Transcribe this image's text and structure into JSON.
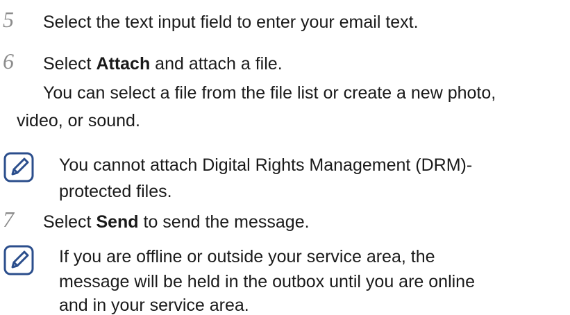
{
  "steps": [
    {
      "number": "5",
      "text": "Select the text input field to enter your email text."
    },
    {
      "number": "6",
      "pre": "Select ",
      "bold": "Attach",
      "post": " and attach a file.",
      "sub": [
        "You can select a file from the file list or create a new photo,",
        "video, or sound."
      ]
    },
    {
      "number": "7",
      "pre": "Select ",
      "bold": "Send",
      "post": " to send the message."
    }
  ],
  "notes": [
    {
      "icon": "note-pencil-icon",
      "lines": [
        "You cannot attach Digital Rights Management (DRM)-",
        "protected files."
      ]
    },
    {
      "icon": "note-pencil-icon",
      "lines": [
        "If you are offline or outside your service area, the",
        "message will be held in the outbox until you are online",
        "and in your service area."
      ]
    }
  ],
  "colors": {
    "step_number": "#8c8c8c",
    "icon_stroke": "#2b4e8c",
    "text": "#1a1a1a"
  }
}
